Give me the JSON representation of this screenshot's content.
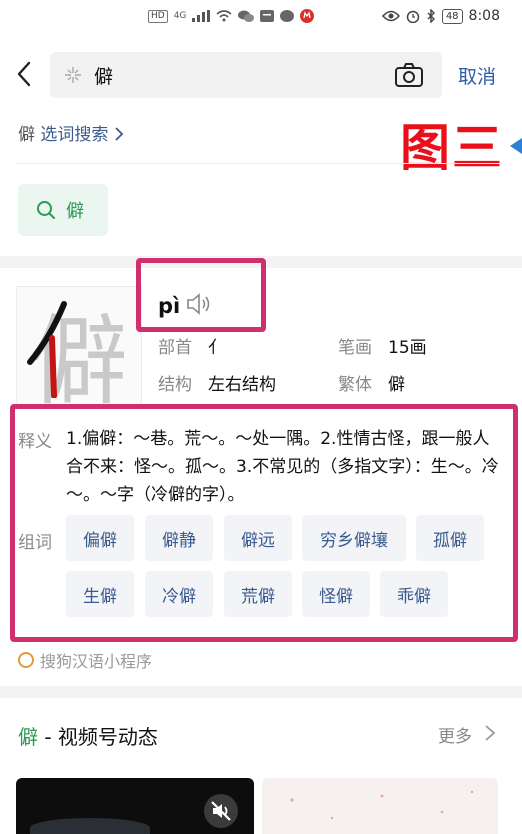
{
  "status_bar": {
    "left_icons": [
      "HD",
      "4G",
      "signal-icon",
      "wifi-icon",
      "wechat-icon",
      "message-icon",
      "bubble-icon",
      "app-icon"
    ],
    "hd_label": "HD",
    "net_label": "4G",
    "battery": "48",
    "time": "8:08"
  },
  "search": {
    "query": "僻",
    "cancel_label": "取消"
  },
  "choose_search": {
    "word": "僻",
    "label": "选词搜索",
    "annotation": "图三"
  },
  "chip": {
    "label": "僻"
  },
  "dictionary": {
    "character": "僻",
    "pinyin": "pì",
    "radical_label": "部首",
    "radical_value": "亻",
    "strokes_label": "笔画",
    "strokes_value": "15画",
    "structure_label": "结构",
    "structure_value": "左右结构",
    "traditional_label": "繁体",
    "traditional_value": "僻",
    "definition_label": "释义",
    "definition": "1.偏僻：～巷。荒～。～处一隅。2.性情古怪，跟一般人合不来：怪～。孤～。3.不常见的（多指文字）：生～。冷～。～字（冷僻的字）。",
    "words_label": "组词",
    "words": [
      "偏僻",
      "僻静",
      "僻远",
      "穷乡僻壤",
      "孤僻",
      "生僻",
      "冷僻",
      "荒僻",
      "怪僻",
      "乖僻"
    ]
  },
  "source": {
    "label": "搜狗汉语小程序"
  },
  "video_section": {
    "keyword": "僻",
    "title_rest": " - 视频号动态",
    "more_label": "更多"
  },
  "colors": {
    "link_blue": "#3b5b8e",
    "green": "#2a9a55",
    "annotation_red": "#e8101a",
    "highlight_box": "#cf2f6e"
  }
}
